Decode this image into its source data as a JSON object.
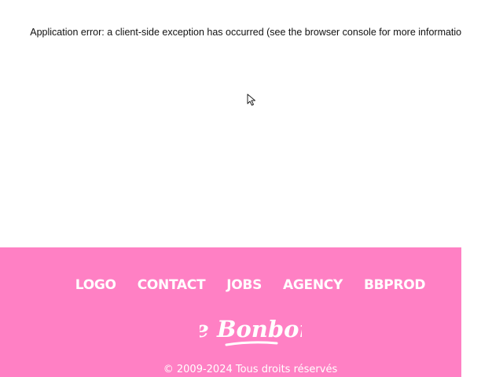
{
  "error": {
    "message": "Application error: a client-side exception has occurred (see the browser console for more information)."
  },
  "footer": {
    "nav": [
      {
        "label": "LOGO"
      },
      {
        "label": "CONTACT"
      },
      {
        "label": "JOBS"
      },
      {
        "label": "AGENCY"
      },
      {
        "label": "BBPROD"
      }
    ],
    "brand": "le Bonbon",
    "copyright": "© 2009-2024 Tous droits réservés"
  },
  "colors": {
    "footer_background": "#ff80c4",
    "footer_text": "#ffffff",
    "error_text": "#111111"
  },
  "icons": {
    "cursor": "mouse-pointer-icon"
  }
}
